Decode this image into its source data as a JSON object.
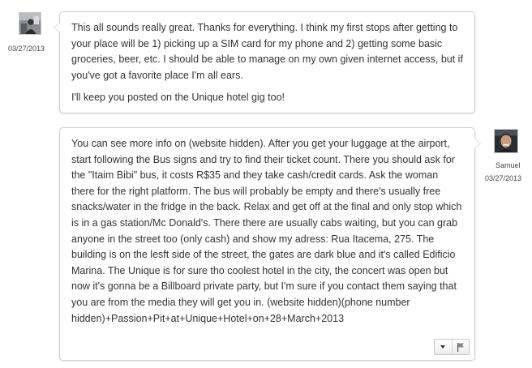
{
  "messages": [
    {
      "side": "left",
      "date": "03/27/2013",
      "paragraphs": [
        "This all sounds really great. Thanks for everything. I think my first stops after getting to your place will be 1) picking up a SIM card for my phone and 2) getting some basic groceries, beer, etc. I should be able to manage on my own given internet access, but if you've got a favorite place I'm all ears.",
        "I'll keep you posted on the Unique hotel gig too!"
      ]
    },
    {
      "side": "right",
      "username": "Samuel",
      "date": "03/27/2013",
      "paragraphs": [
        "You can see more info on (website hidden). After you get your luggage at the airport, start following the Bus signs and try to find their ticket count. There you should ask for the \"Itaim Bibi\" bus, it costs R$35 and they take cash/credit cards. Ask the woman there for the right platform. The bus will probably be empty and there's usually free snacks/water in the fridge in the back. Relax and get off at the final and only stop which is in a gas station/Mc Donald's. There there are usually cabs waiting, but you can grab anyone in the street too (only cash) and show my adress: Rua Itacema, 275. The building is on the lesft side of the street, the gates are dark blue and it's called Edificio Marina. The Unique is for sure tho coolest hotel in the city, the concert was open but now it's gonna be a Billboard private party, but I'm sure if you contact them saying that you are from the media they will get you in. (website hidden)(phone number hidden)+Passion+Pit+at+Unique+Hotel+on+28+March+2013"
      ],
      "actions": {
        "menu_icon": "chevron-down-icon",
        "flag_icon": "flag-icon"
      }
    }
  ]
}
